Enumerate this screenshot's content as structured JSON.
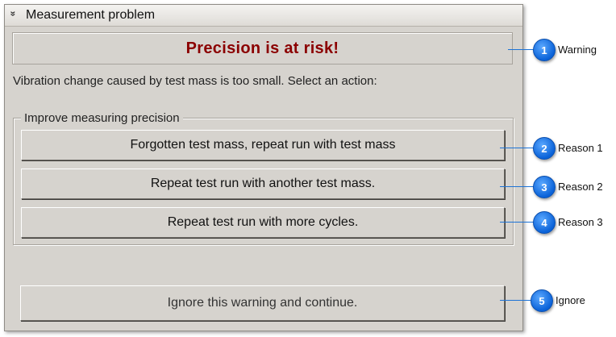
{
  "panel": {
    "title": "Measurement problem",
    "collapse_icon": "double-chevron-down-icon",
    "collapse_glyph": "»"
  },
  "warning": {
    "text": "Precision is at risk!",
    "color": "#8b0000"
  },
  "description": "Vibration change caused by test mass is too small. Select an action:",
  "group": {
    "legend": "Improve measuring precision",
    "buttons": [
      "Forgotten test mass, repeat run with test mass",
      "Repeat test run with another test mass.",
      "Repeat test run with more cycles."
    ]
  },
  "ignore_button": "Ignore this warning and continue.",
  "callouts": [
    {
      "number": "1",
      "label": "Warning"
    },
    {
      "number": "2",
      "label": "Reason 1"
    },
    {
      "number": "3",
      "label": "Reason 2"
    },
    {
      "number": "4",
      "label": "Reason 3"
    },
    {
      "number": "5",
      "label": "Ignore"
    }
  ],
  "colors": {
    "callout_badge": "#0a62d8",
    "panel_bg": "#d6d3ce"
  }
}
